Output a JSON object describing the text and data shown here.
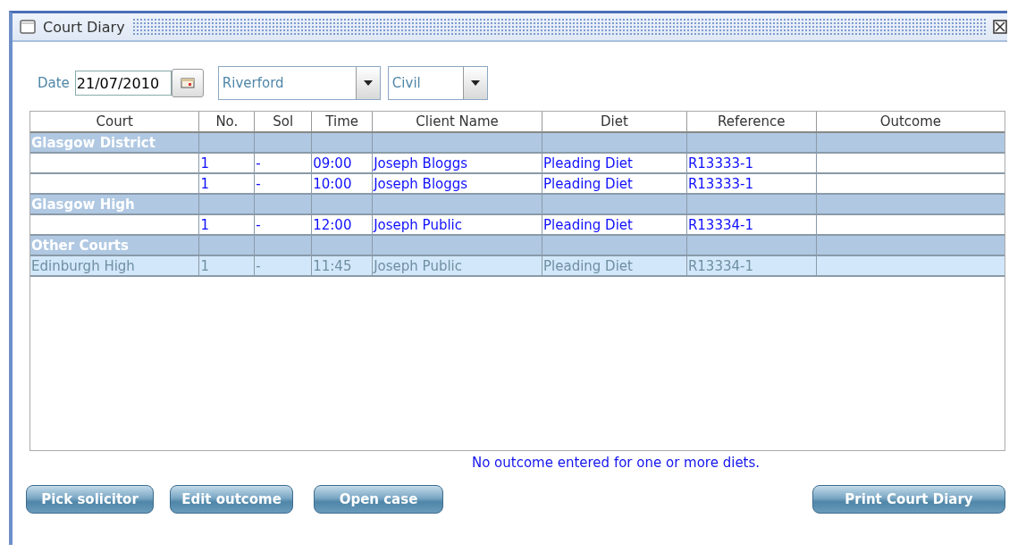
{
  "window": {
    "title": "Court Diary"
  },
  "filters": {
    "date_label": "Date",
    "date": "21/07/2010",
    "court": "Riverford",
    "type": "Civil"
  },
  "table": {
    "columns": [
      "Court",
      "No.",
      "Sol",
      "Time",
      "Client Name",
      "Diet",
      "Reference",
      "Outcome"
    ],
    "rows": [
      {
        "kind": "group",
        "court": "Glasgow District"
      },
      {
        "kind": "entry",
        "selected": false,
        "cells": [
          "",
          "1",
          "-",
          "09:00",
          "Joseph Bloggs",
          "Pleading Diet",
          "R13333-1",
          ""
        ]
      },
      {
        "kind": "entry",
        "selected": false,
        "cells": [
          "",
          "1",
          "-",
          "10:00",
          "Joseph Bloggs",
          "Pleading Diet",
          "R13333-1",
          ""
        ]
      },
      {
        "kind": "group",
        "court": "Glasgow High"
      },
      {
        "kind": "entry",
        "selected": false,
        "cells": [
          "",
          "1",
          "-",
          "12:00",
          "Joseph Public",
          "Pleading Diet",
          "R13334-1",
          ""
        ]
      },
      {
        "kind": "group",
        "court": "Other Courts"
      },
      {
        "kind": "entry",
        "selected": true,
        "cells": [
          "Edinburgh High",
          "1",
          "-",
          "11:45",
          "Joseph Public",
          "Pleading Diet",
          "R13334-1",
          ""
        ]
      }
    ]
  },
  "message": "No outcome entered for one or more diets.",
  "buttons_left": [
    "Pick solicitor",
    "Edit outcome",
    "Open case"
  ],
  "buttons_right": [
    "Print Court Diary"
  ]
}
